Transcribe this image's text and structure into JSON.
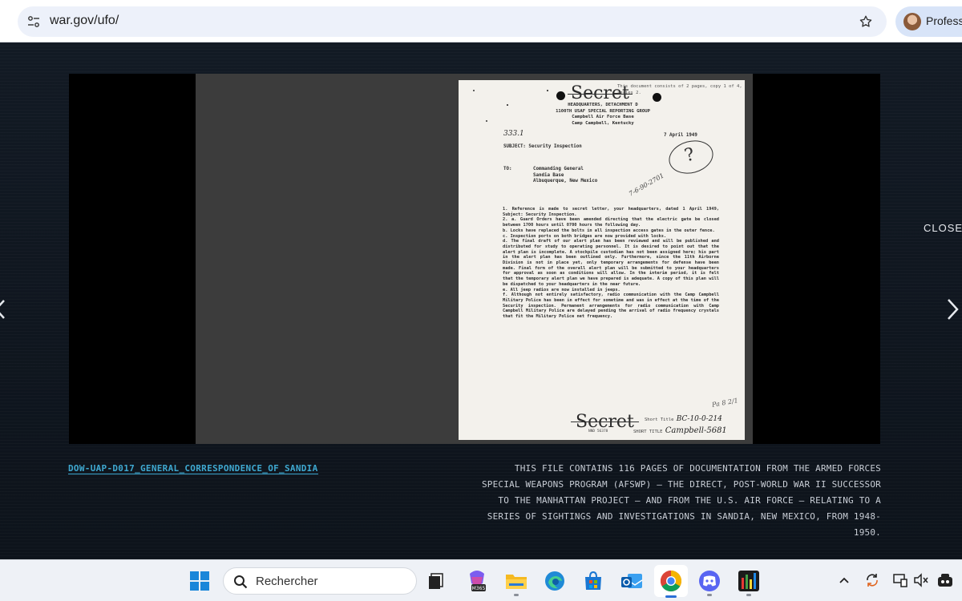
{
  "browser": {
    "url": "war.gov/ufo/",
    "profile_label": "Professi"
  },
  "viewer": {
    "close_label": "CLOSE",
    "file_name": "DOW-UAP-D017_GENERAL_CORRESPONDENCE_OF_SANDIA",
    "description": "THIS FILE CONTAINS 116 PAGES OF DOCUMENTATION FROM THE ARMED FORCES SPECIAL WEAPONS PROGRAM (AFSWP) – THE DIRECT, POST-WORLD WAR II SUCCESSOR TO THE MANHATTAN PROJECT – AND FROM THE U.S. AIR FORCE – RELATING TO A SERIES OF SIGHTINGS AND INVESTIGATIONS IN SANDIA, NEW MEXICO, FROM 1948-1950."
  },
  "document": {
    "stamp_top": "Secret",
    "top_note": "This document consists of 2 pages, copy 1 of 4, series 2.",
    "header": "HEADQUARTERS, DETACHMENT D\n1100TH USAF SPECIAL REPORTING GROUP\nCampbell Air Force Base\nCamp Campbell, Kentucky",
    "date": "7 April 1949",
    "file_number": "333.1",
    "subject": "SUBJECT:  Security Inspection",
    "to_label": "TO:",
    "to_address": "Commanding General\nSandia Base\nAlbuquerque, New Mexico",
    "circle_mark": "?",
    "scribble": "7-6-90-2701",
    "body": "      1.  Reference is made to secret letter, your headquarters, dated 1 April 1949, Subject: Security Inspection.\n      2.  a.  Guard Orders have been amended directing that the electric gate be closed between 1700 hours until 0700 hours the following day.\n          b.  Locks have replaced the bolts in all inspection access gates in the outer fence.\n          c.  Inspection ports on both bridges are now provided with locks.\n          d.  The final draft of our alert plan has been reviewed and will be published and distributed for study to operating personnel. It is desired to point out that the alert plan is incomplete. A stockpile custodian has not been assigned here; his part in the alert plan has been outlined only. Furthermore, since the 11th Airborne Division is not in place yet, only temporary arrangements for defense have been made. Final form of the overall alert plan will be submitted to your headquarters for approval as soon as conditions will allow. In the interim period, it is felt that the temporary alert plan we have prepared is adequate. A copy of this plan will be dispatched to your headquarters in the near future.\n          e.  All jeep radios are now installed in jeeps.\n          f.  Although not entirely satisfactory, radio communication with the Camp Campbell Military Police has been in effect for sometime and was in effect at the time of the Security inspection. Permanent arrangements for radio communication with Camp Campbell Military Police are delayed pending the arrival of radio frequency crystals that fit the Military Police net frequency.",
    "margin_note": "Pa 8 2/1",
    "stamp_bottom": "Secret",
    "nnd": "NND 56378",
    "short_title_1_label": "Short Title",
    "short_title_1_value": "BC-10-0-214",
    "short_title_2_label": "SHORT TITLE",
    "short_title_2_value": "Campbell-5681"
  },
  "taskbar": {
    "search_placeholder": "Rechercher",
    "m365_badge": "M365"
  }
}
